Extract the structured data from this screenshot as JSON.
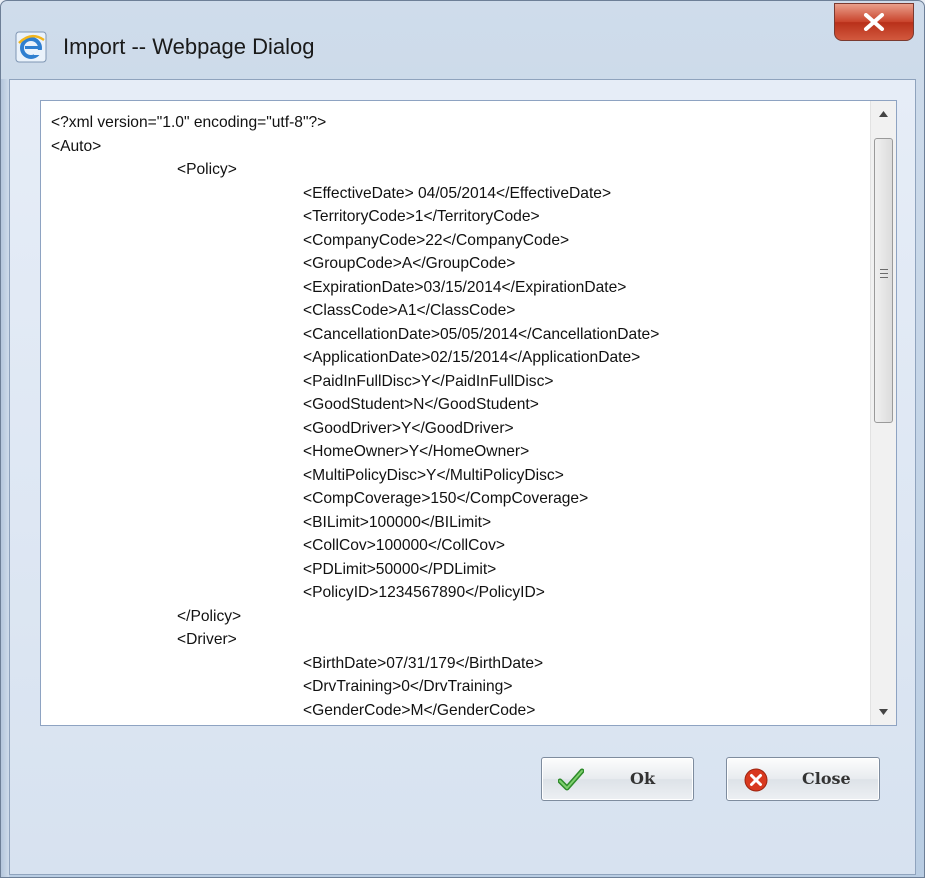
{
  "window": {
    "title": "Import -- Webpage Dialog",
    "icons": {
      "app": "internet-explorer-icon",
      "close": "close-icon"
    }
  },
  "xml_text": {
    "lines": [
      "<?xml version=\"1.0\" encoding=\"utf-8\"?>",
      "<Auto>",
      "\t\t<Policy>",
      "\t\t\t\t<EffectiveDate> 04/05/2014</EffectiveDate>",
      "\t\t\t\t<TerritoryCode>1</TerritoryCode>",
      "\t\t\t\t<CompanyCode>22</CompanyCode>",
      "\t\t\t\t<GroupCode>A</GroupCode>",
      "\t\t\t\t<ExpirationDate>03/15/2014</ExpirationDate>",
      "\t\t\t\t<ClassCode>A1</ClassCode>",
      "\t\t\t\t<CancellationDate>05/05/2014</CancellationDate>",
      "\t\t\t\t<ApplicationDate>02/15/2014</ApplicationDate>",
      "\t\t\t\t<PaidInFullDisc>Y</PaidInFullDisc>",
      "\t\t\t\t<GoodStudent>N</GoodStudent>",
      "\t\t\t\t<GoodDriver>Y</GoodDriver>",
      "\t\t\t\t<HomeOwner>Y</HomeOwner>",
      "\t\t\t\t<MultiPolicyDisc>Y</MultiPolicyDisc>",
      "\t\t\t\t<CompCoverage>150</CompCoverage>",
      "\t\t\t\t<BILimit>100000</BILimit>",
      "\t\t\t\t<CollCov>100000</CollCov>",
      "\t\t\t\t<PDLimit>50000</PDLimit>",
      "\t\t\t\t<PolicyID>1234567890</PolicyID>",
      "\t\t</Policy>",
      "\t\t<Driver>",
      "\t\t\t\t<BirthDate>07/31/179</BirthDate>",
      "\t\t\t\t<DrvTraining>0</DrvTraining>",
      "\t\t\t\t<GenderCode>M</GenderCode>"
    ]
  },
  "buttons": {
    "ok": {
      "label": "Ok",
      "icon": "checkmark-icon"
    },
    "close": {
      "label": "Close",
      "icon": "cancel-x-icon"
    }
  },
  "colors": {
    "close_button_red": "#c9432b",
    "ok_check_green": "#3fa33a",
    "cancel_icon_red": "#d8391f"
  }
}
